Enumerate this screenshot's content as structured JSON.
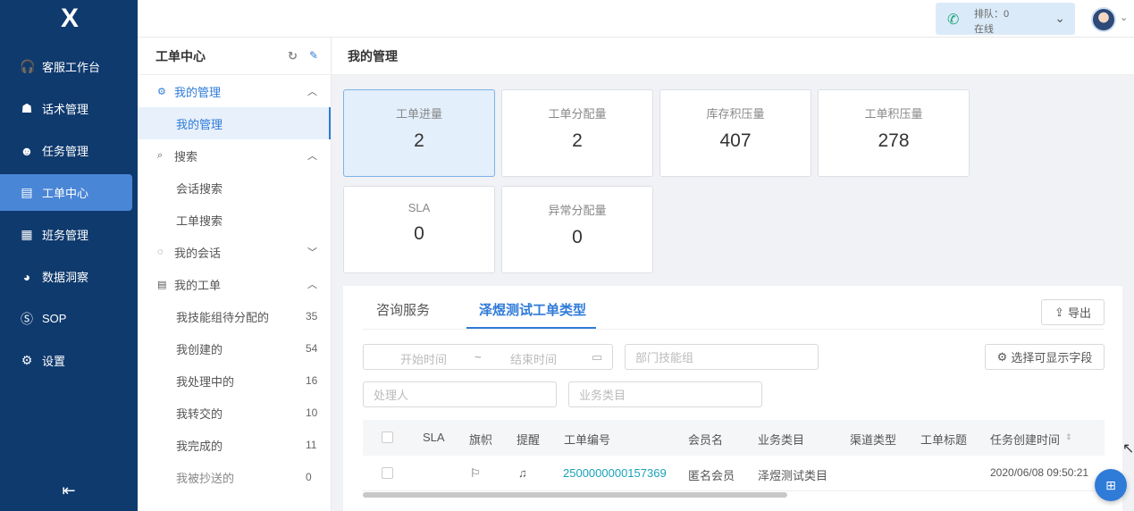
{
  "nav": {
    "logo": "X",
    "items": [
      {
        "label": "客服工作台",
        "icon": "headset-icon",
        "glyph": "🎧"
      },
      {
        "label": "话术管理",
        "icon": "chat-robot-icon",
        "glyph": "☗"
      },
      {
        "label": "任务管理",
        "icon": "user-task-icon",
        "glyph": "☻"
      },
      {
        "label": "工单中心",
        "icon": "ticket-icon",
        "glyph": "▤"
      },
      {
        "label": "班务管理",
        "icon": "calendar-icon",
        "glyph": "▦"
      },
      {
        "label": "数据洞察",
        "icon": "pie-chart-icon",
        "glyph": "◕"
      },
      {
        "label": "SOP",
        "icon": "sop-icon",
        "glyph": "Ⓢ"
      },
      {
        "label": "设置",
        "icon": "gear-icon",
        "glyph": "⚙"
      }
    ],
    "collapse_glyph": "⇤"
  },
  "topbar": {
    "queue_label": "排队：0",
    "status": "在线"
  },
  "sub": {
    "title": "工单中心",
    "groups": {
      "my_manage": {
        "label": "我的管理",
        "child": "我的管理"
      },
      "search": {
        "label": "搜索",
        "children": [
          "会话搜索",
          "工单搜索"
        ]
      },
      "my_conv": {
        "label": "我的会话"
      },
      "my_tickets": {
        "label": "我的工单",
        "children": [
          {
            "label": "我技能组待分配的",
            "count": "35"
          },
          {
            "label": "我创建的",
            "count": "54"
          },
          {
            "label": "我处理中的",
            "count": "16"
          },
          {
            "label": "我转交的",
            "count": "10"
          },
          {
            "label": "我完成的",
            "count": "11"
          },
          {
            "label": "我被抄送的",
            "count": "0"
          }
        ]
      }
    }
  },
  "main": {
    "title": "我的管理",
    "stats": [
      {
        "label": "工单进量",
        "value": "2"
      },
      {
        "label": "工单分配量",
        "value": "2"
      },
      {
        "label": "库存积压量",
        "value": "407"
      },
      {
        "label": "工单积压量",
        "value": "278"
      },
      {
        "label": "SLA",
        "value": "0"
      },
      {
        "label": "异常分配量",
        "value": "0"
      }
    ],
    "tabs": [
      "咨询服务",
      "泽煜测试工单类型"
    ],
    "export_label": "导出",
    "filters": {
      "start_time": "开始时间",
      "range_sep": "~",
      "end_time": "结束时间",
      "dept_skill": "部门技能组",
      "handler": "处理人",
      "biz_category": "业务类目",
      "select_fields": "选择可显示字段"
    },
    "table": {
      "columns": [
        "SLA",
        "旗帜",
        "提醒",
        "工单编号",
        "会员名",
        "业务类目",
        "渠道类型",
        "工单标题",
        "任务创建时间"
      ],
      "rows": [
        {
          "sla": "",
          "ticket_no": "2500000000157369",
          "member": "匿名会员",
          "category": "泽煜测试类目",
          "channel": "",
          "title": "",
          "created": "2020/06/08 09:50:21"
        }
      ]
    }
  }
}
